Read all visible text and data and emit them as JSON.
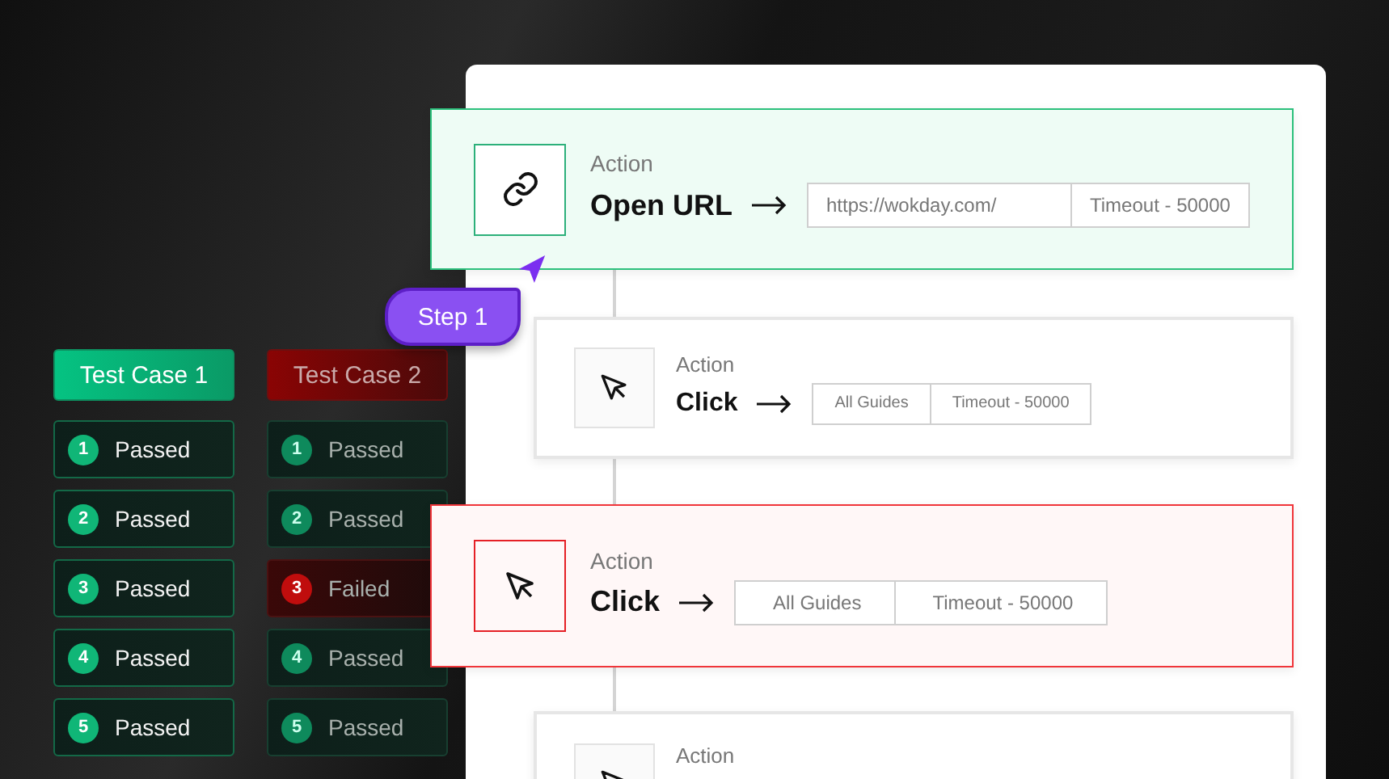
{
  "test_cases": [
    {
      "label": "Test Case 1",
      "failed": false,
      "selected": true,
      "steps": [
        {
          "number": "1",
          "label": "Passed",
          "failed": false
        },
        {
          "number": "2",
          "label": "Passed",
          "failed": false
        },
        {
          "number": "3",
          "label": "Passed",
          "failed": false
        },
        {
          "number": "4",
          "label": "Passed",
          "failed": false
        },
        {
          "number": "5",
          "label": "Passed",
          "failed": false
        }
      ]
    },
    {
      "label": "Test Case 2",
      "failed": true,
      "selected": false,
      "steps": [
        {
          "number": "1",
          "label": "Passed",
          "failed": false
        },
        {
          "number": "2",
          "label": "Passed",
          "failed": false
        },
        {
          "number": "3",
          "label": "Failed",
          "failed": true
        },
        {
          "number": "4",
          "label": "Passed",
          "failed": false
        },
        {
          "number": "5",
          "label": "Passed",
          "failed": false
        }
      ]
    }
  ],
  "step_badge": {
    "label": "Step 1"
  },
  "actions": [
    {
      "label": "Action",
      "title": "Open URL",
      "kind": "link",
      "highlighted": true,
      "failed": false,
      "fields": [
        "https://wokday.com/",
        "Timeout - 50000"
      ]
    },
    {
      "label": "Action",
      "title": "Click",
      "kind": "pointer",
      "highlighted": false,
      "failed": false,
      "fields": [
        "All Guides",
        "Timeout - 50000"
      ]
    },
    {
      "label": "Action",
      "title": "Click",
      "kind": "pointer",
      "highlighted": true,
      "failed": true,
      "fields": [
        "All Guides",
        "Timeout - 50000"
      ]
    },
    {
      "label": "Action",
      "kind": "pointer",
      "highlighted": false,
      "failed": false
    }
  ]
}
